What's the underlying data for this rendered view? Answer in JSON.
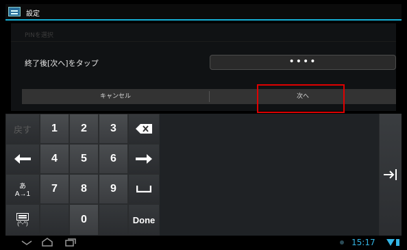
{
  "titlebar": {
    "title": "設定",
    "icon": "settings-icon"
  },
  "dialog": {
    "pin_hint": "PINを選択",
    "instruction": "終了後[次へ]をタップ",
    "pin_value": "••••",
    "cancel_label": "キャンセル",
    "next_label": "次へ"
  },
  "keyboard": {
    "back_label": "戻す",
    "keys": {
      "k1": "1",
      "k2": "2",
      "k3": "3",
      "k4": "4",
      "k5": "5",
      "k6": "6",
      "k7": "7",
      "k8": "8",
      "k9": "9",
      "k0": "0",
      "done": "Done",
      "mode_label": "あ",
      "mode_sub": "A→1",
      "emoji_sub": "(^-^)"
    },
    "icons": [
      "backspace-icon",
      "left-arrow-icon",
      "right-arrow-icon",
      "space-icon",
      "tab-icon"
    ]
  },
  "navbar": {
    "time": "15:17"
  },
  "colors": {
    "accent": "#16b0d6",
    "highlight": "#e00000",
    "clock": "#33b5e5"
  }
}
